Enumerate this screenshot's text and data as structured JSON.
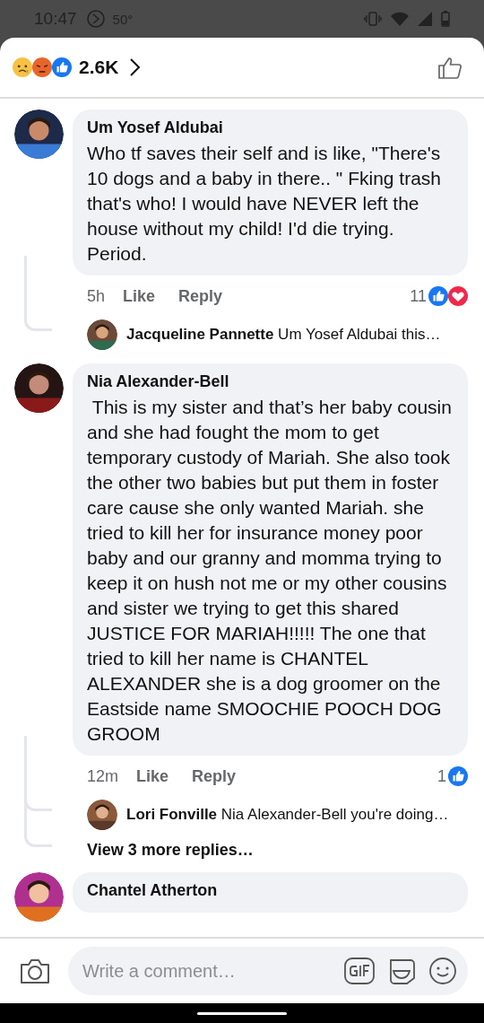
{
  "status_bar": {
    "time": "10:47",
    "temperature": "50°"
  },
  "header": {
    "reaction_types": [
      {
        "kind": "sad"
      },
      {
        "kind": "angry"
      },
      {
        "kind": "like"
      }
    ],
    "count": "2.6K"
  },
  "comments": [
    {
      "author": "Um Yosef Aldubai",
      "text": "Who tf saves their self and is like, \"There's 10 dogs and a baby in there.. \" Fking trash that's who! I would have NEVER left the house without my child! I'd die trying. Period.",
      "time": "5h",
      "like_label": "Like",
      "reply_label": "Reply",
      "reaction_count": "11",
      "reactions": [
        {
          "kind": "like"
        },
        {
          "kind": "love"
        }
      ],
      "replies": [
        {
          "author": "Jacqueline Pannette",
          "text": "Um Yosef Aldubai this…"
        }
      ]
    },
    {
      "author": "Nia Alexander-Bell",
      "text": " This is my sister and that’s her baby cousin and she had fought the mom to get temporary custody of Mariah. She also took the other two babies but put them in foster care cause she only wanted Mariah. she tried to kill her for insurance money poor baby and our granny and momma trying to keep it on hush not me or my other cousins and sister we trying to get this shared JUSTICE FOR MARIAH!!!!! The one that tried to kill her name is CHANTEL ALEXANDER she is a dog groomer on the Eastside name SMOOCHIE POOCH DOG GROOM",
      "time": "12m",
      "like_label": "Like",
      "reply_label": "Reply",
      "reaction_count": "1",
      "reactions": [
        {
          "kind": "like"
        }
      ],
      "replies": [
        {
          "author": "Lori Fonville",
          "text": "Nia Alexander-Bell you're doing…"
        }
      ],
      "view_more": "View 3 more replies…"
    },
    {
      "author": "Chantel Atherton"
    }
  ],
  "composer": {
    "placeholder": "Write a comment…"
  }
}
